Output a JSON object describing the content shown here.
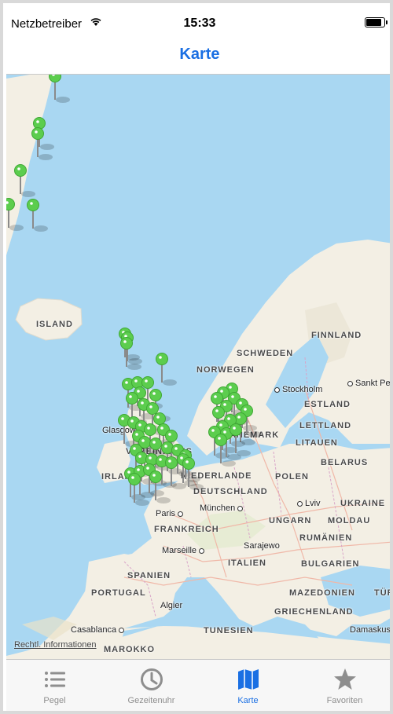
{
  "status_bar": {
    "carrier": "Netzbetreiber",
    "time": "15:33",
    "battery_level": 0.95
  },
  "nav": {
    "title": "Karte"
  },
  "map": {
    "countries": {
      "island": "ISLAND",
      "finnland": "FINNLAND",
      "schweden": "SCHWEDEN",
      "norwegen": "NORWEGEN",
      "estland": "ESTLAND",
      "lettland": "LETTLAND",
      "litauen": "LITAUEN",
      "belarus": "BELARUS",
      "polen": "POLEN",
      "deutschland": "DEUTSCHLAND",
      "niederlande": "NIEDERLANDE",
      "ukraine": "UKRAINE",
      "moldau": "MOLDAU",
      "ungarn": "UNGARN",
      "rumaenien": "RUMÄNIEN",
      "frankreich": "FRANKREICH",
      "italien": "ITALIEN",
      "bulgarien": "BULGARIEN",
      "spanien": "SPANIEN",
      "portugal": "PORTUGAL",
      "mazedonien": "MAZEDONIEN",
      "griechenland": "GRIECHENLAND",
      "tuerkei": "TÜRKEI",
      "tunesien": "TUNESIEN",
      "marokko": "MAROKKO",
      "irland": "IRLAND",
      "vereinigtes_koenigreich": "VEREINIGTES",
      "daenemark": "DÄNEMARK"
    },
    "cities": {
      "stockholm": "Stockholm",
      "sankt_petersburg": "Sankt Pet",
      "glasgow": "Glasgow",
      "paris": "Paris",
      "muenchen": "München",
      "lviv": "Lviv",
      "marseille": "Marseille",
      "sarajewo": "Sarajewo",
      "algier": "Algier",
      "casablanca": "Casablanca",
      "damaskus": "Damaskus"
    },
    "legal_link": "Rechtl. Informationen",
    "pin_color": "#5ccd4e",
    "water_color": "#a9d7f2",
    "land_color": "#f3efe4"
  },
  "tabs": [
    {
      "label": "Pegel",
      "icon": "list-icon",
      "active": false
    },
    {
      "label": "Gezeitenuhr",
      "icon": "clock-icon",
      "active": false
    },
    {
      "label": "Karte",
      "icon": "map-icon",
      "active": true
    },
    {
      "label": "Favoriten",
      "icon": "star-icon",
      "active": false
    }
  ],
  "accent_color": "#1a6fe3"
}
